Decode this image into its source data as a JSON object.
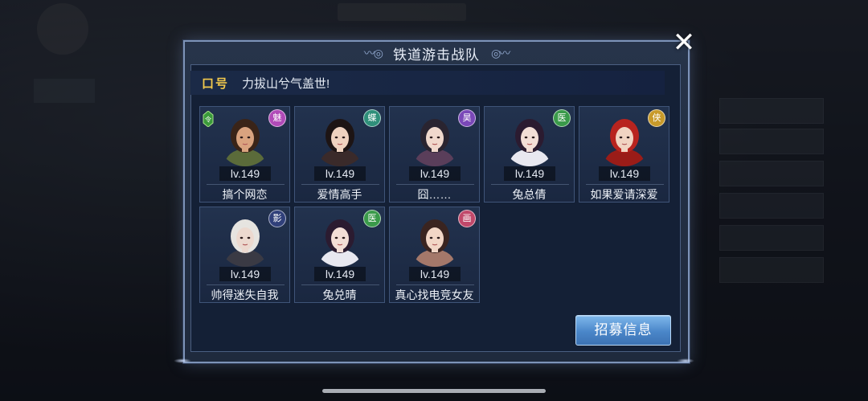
{
  "dialog": {
    "title": "铁道游击战队",
    "slogan_label": "口号",
    "slogan_text": "力拔山兮气盖世!",
    "recruit_label": "招募信息",
    "close_symbol": "✕"
  },
  "members": [
    {
      "level": "lv.149",
      "name": "搞个网恋",
      "badge": "魅",
      "badge_color": "#b04ab8",
      "skin": "#d9a37f",
      "hair": "#3a2418",
      "robe": "#5b6b3a",
      "leader": true
    },
    {
      "level": "lv.149",
      "name": "爱情高手",
      "badge": "蝶",
      "badge_color": "#2f8f7a",
      "skin": "#efd2c0",
      "hair": "#1d1414",
      "robe": "#3a2a2a",
      "leader": false
    },
    {
      "level": "lv.149",
      "name": "囧……",
      "badge": "昊",
      "badge_color": "#7a48b8",
      "skin": "#f0d8cc",
      "hair": "#2a2430",
      "robe": "#5a3e5a",
      "leader": false
    },
    {
      "level": "lv.149",
      "name": "兔总倩",
      "badge": "医",
      "badge_color": "#3a9a4a",
      "skin": "#f3ded6",
      "hair": "#2b1b30",
      "robe": "#e8e8f0",
      "leader": false
    },
    {
      "level": "lv.149",
      "name": "如果爱请深爱",
      "badge": "侠",
      "badge_color": "#c89a2a",
      "skin": "#f1d4c2",
      "hair": "#b8241f",
      "robe": "#9a1c18",
      "leader": false
    },
    {
      "level": "lv.149",
      "name": "帅得迷失自我",
      "badge": "影",
      "badge_color": "#30407a",
      "skin": "#ecd9cf",
      "hair": "#e6e4e0",
      "robe": "#3a3a44",
      "leader": false
    },
    {
      "level": "lv.149",
      "name": "兔兑晴",
      "badge": "医",
      "badge_color": "#3a9a4a",
      "skin": "#f3ded6",
      "hair": "#2b1b30",
      "robe": "#e8e8f0",
      "leader": false
    },
    {
      "level": "lv.149",
      "name": "真心找电竞女友",
      "badge": "画",
      "badge_color": "#c0486a",
      "skin": "#f2d6c6",
      "hair": "#3a2420",
      "robe": "#a4786a",
      "leader": false
    }
  ]
}
